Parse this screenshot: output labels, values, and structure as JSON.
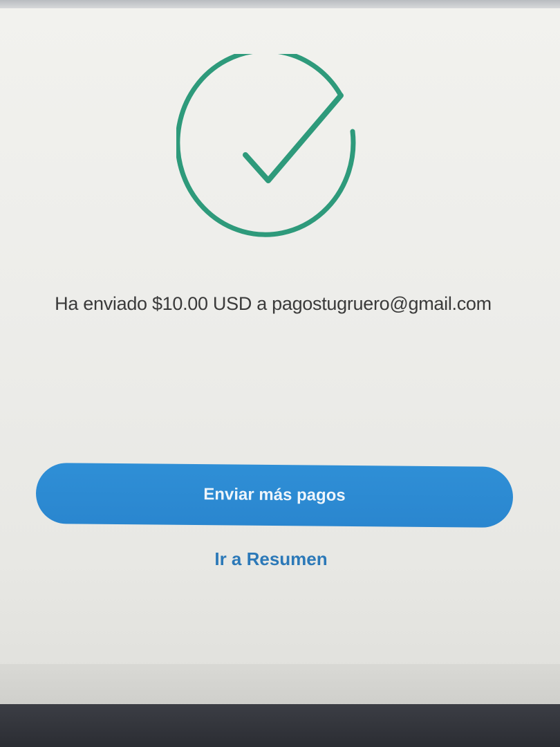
{
  "confirmation": {
    "message": "Ha enviado $10.00 USD a pagostugruero@gmail.com",
    "icon": "check-circle-icon",
    "icon_color": "#2e9a7b"
  },
  "actions": {
    "primary_label": "Enviar más pagos",
    "secondary_label": "Ir a Resumen",
    "primary_color": "#2f8fd6",
    "link_color": "#2c79b8"
  }
}
